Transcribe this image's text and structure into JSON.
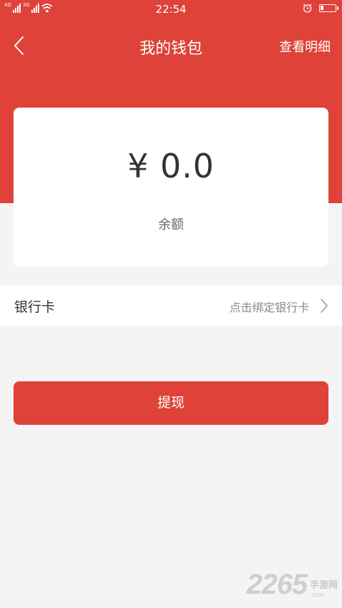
{
  "status_bar": {
    "time": "22:54",
    "network_labels": [
      "4G",
      "3G"
    ],
    "battery_percent": 20
  },
  "nav": {
    "title": "我的钱包",
    "right_action": "查看明细",
    "back_icon": "chevron-left-icon"
  },
  "balance": {
    "amount": "¥ 0.0",
    "label": "余额"
  },
  "bank_card": {
    "label": "银行卡",
    "action": "点击绑定银行卡",
    "icon": "chevron-right-icon"
  },
  "withdraw": {
    "label": "提现"
  },
  "watermark": {
    "number": "2265",
    "site_name": "手游网",
    "site_domain": ".com"
  },
  "colors": {
    "primary_red": "#de4239",
    "background": "#f4f4f4",
    "card": "#ffffff"
  }
}
